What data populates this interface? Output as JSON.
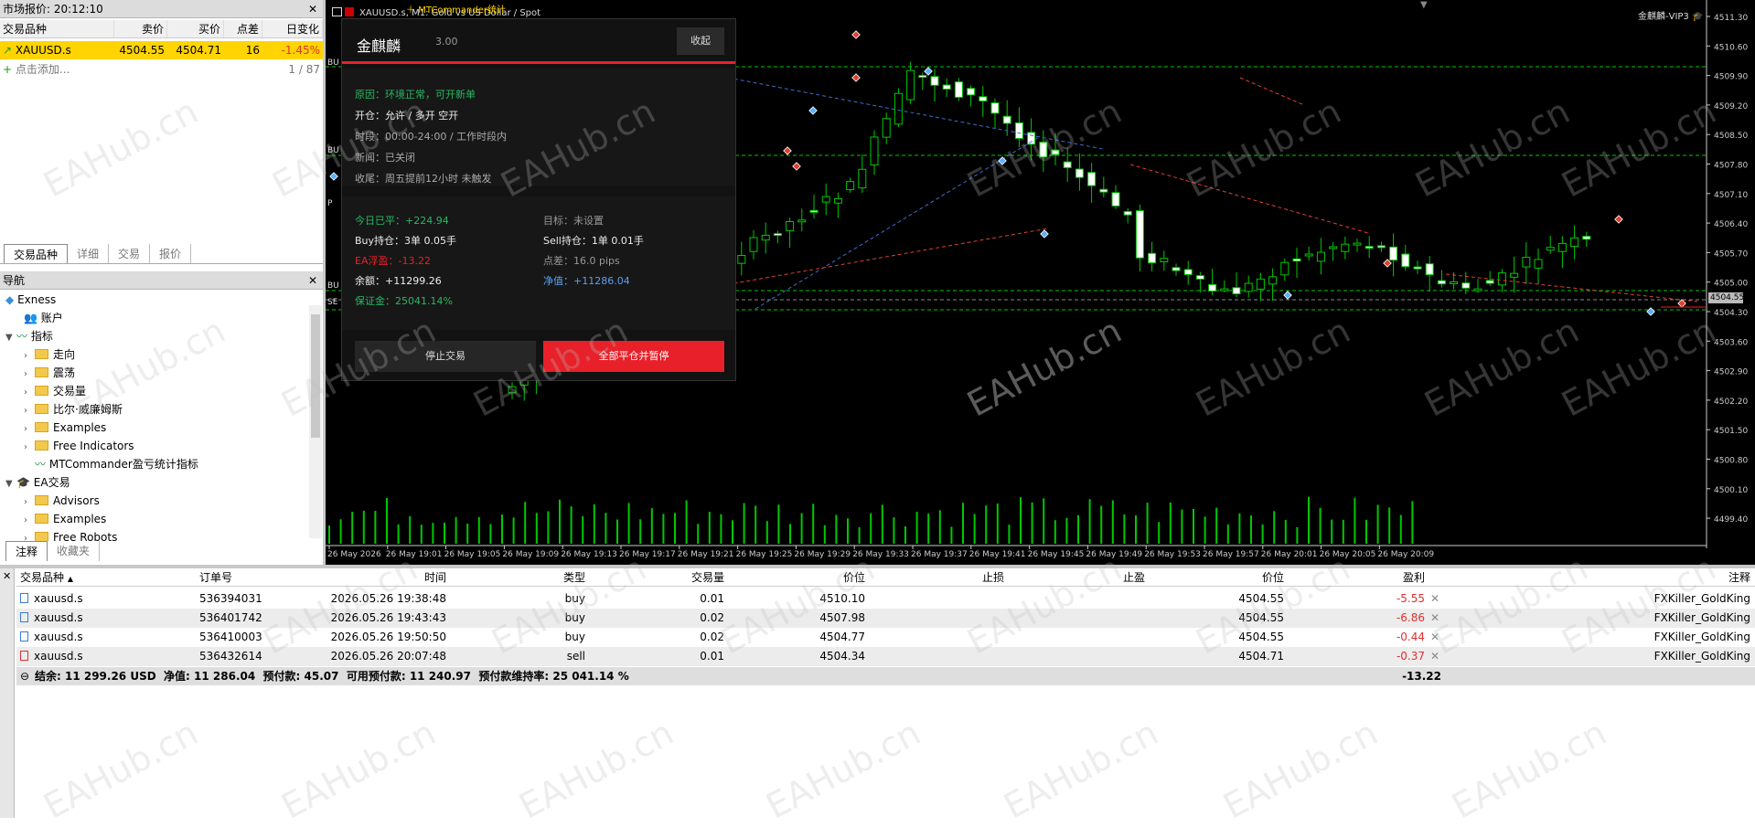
{
  "market_watch": {
    "title": "市场报价: 20:12:10",
    "columns": [
      "交易品种",
      "卖价",
      "买价",
      "点差",
      "日变化"
    ],
    "rows": [
      {
        "symbol": "XAUUSD.s",
        "bid": "4504.55",
        "ask": "4504.71",
        "spread": "16",
        "change": "-1.45%"
      }
    ],
    "add_label": "点击添加...",
    "count": "1 / 87",
    "tabs": [
      "交易品种",
      "详细",
      "交易",
      "报价"
    ]
  },
  "navigator": {
    "title": "导航",
    "items": [
      {
        "label": "Exness"
      },
      {
        "label": "账户"
      },
      {
        "label": "指标"
      },
      {
        "label": "走向"
      },
      {
        "label": "震荡"
      },
      {
        "label": "交易量"
      },
      {
        "label": "比尔·威廉姆斯"
      },
      {
        "label": "Examples"
      },
      {
        "label": "Free Indicators"
      },
      {
        "label": "MTCommander盈亏统计指标"
      },
      {
        "label": "EA交易"
      },
      {
        "label": "Advisors"
      },
      {
        "label": "Examples"
      },
      {
        "label": "Free Robots"
      }
    ],
    "tabs": [
      "注释",
      "收藏夹"
    ]
  },
  "chart": {
    "symbol_title": "XAUUSD.s, M1:  Gold vs US Dollar / Spot",
    "indicator_label": "MTCommander统计",
    "ea_label": "金麒麟-VIP3",
    "current_price": "4504.55",
    "price_ticks": [
      "4511.30",
      "4510.60",
      "4509.90",
      "4509.20",
      "4508.50",
      "4507.80",
      "4507.10",
      "4506.40",
      "4505.70",
      "4505.00",
      "4504.30",
      "4503.60",
      "4502.90",
      "4502.20",
      "4501.50",
      "4500.80",
      "4500.10",
      "4499.40"
    ],
    "time_ticks": [
      "26 May 2026",
      "26 May 19:01",
      "26 May 19:05",
      "26 May 19:09",
      "26 May 19:13",
      "26 May 19:17",
      "26 May 19:21",
      "26 May 19:25",
      "26 May 19:29",
      "26 May 19:33",
      "26 May 19:37",
      "26 May 19:41",
      "26 May 19:45",
      "26 May 19:49",
      "26 May 19:53",
      "26 May 19:57",
      "26 May 20:01",
      "26 May 20:05",
      "26 May 20:09"
    ],
    "side_labels": [
      "BU",
      "BU",
      "BU",
      "SE",
      "P"
    ]
  },
  "ea_panel": {
    "name": "金麒麟",
    "version": "3.00",
    "collapse": "收起",
    "reason_label": "原因：",
    "reason_value": "环境正常，可开新单",
    "open_label": "开仓：",
    "open_value": "允许 / 多开 空开",
    "session_label": "时段：",
    "session_value": "00:00-24:00 / 工作时段内",
    "news_label": "新闻：",
    "news_value": "已关闭",
    "close_label": "收尾：",
    "close_value": "周五提前12小时 未触发",
    "today_label": "今日已平：",
    "today_value": "+224.94",
    "target_label": "目标：",
    "target_value": "未设置",
    "buy_label": "Buy持仓：",
    "buy_value": "3单 0.05手",
    "sell_label": "Sell持仓：",
    "sell_value": "1单 0.01手",
    "ea_float_label": "EA浮盈：",
    "ea_float_value": "-13.22",
    "spread_label": "点差：",
    "spread_value": "16.0 pips",
    "balance_label": "余额：",
    "balance_value": "+11299.26",
    "equity_label": "净值：",
    "equity_value": "+11286.04",
    "margin_label": "保证金：",
    "margin_value": "25041.14%",
    "stop_btn": "停止交易",
    "closeall_btn": "全部平仓并暂停"
  },
  "trade": {
    "columns": [
      "交易品种",
      "订单号",
      "时间",
      "类型",
      "交易量",
      "价位",
      "止损",
      "止盈",
      "价位",
      "盈利",
      "注释"
    ],
    "rows": [
      {
        "symbol": "xauusd.s",
        "ticket": "536394031",
        "time": "2026.05.26 19:38:48",
        "type": "buy",
        "volume": "0.01",
        "price": "4510.10",
        "sl": "",
        "tp": "",
        "cur": "4504.55",
        "profit": "-5.55",
        "comment": "FXKiller_GoldKing"
      },
      {
        "symbol": "xauusd.s",
        "ticket": "536401742",
        "time": "2026.05.26 19:43:43",
        "type": "buy",
        "volume": "0.02",
        "price": "4507.98",
        "sl": "",
        "tp": "",
        "cur": "4504.55",
        "profit": "-6.86",
        "comment": "FXKiller_GoldKing"
      },
      {
        "symbol": "xauusd.s",
        "ticket": "536410003",
        "time": "2026.05.26 19:50:50",
        "type": "buy",
        "volume": "0.02",
        "price": "4504.77",
        "sl": "",
        "tp": "",
        "cur": "4504.55",
        "profit": "-0.44",
        "comment": "FXKiller_GoldKing"
      },
      {
        "symbol": "xauusd.s",
        "ticket": "536432614",
        "time": "2026.05.26 20:07:48",
        "type": "sell",
        "volume": "0.01",
        "price": "4504.34",
        "sl": "",
        "tp": "",
        "cur": "4504.71",
        "profit": "-0.37",
        "comment": "FXKiller_GoldKing"
      }
    ],
    "summary": "结余: 11 299.26 USD  净值: 11 286.04  预付款: 45.07  可用预付款: 11 240.97  预付款维持率: 25 041.14 %",
    "summary_profit": "-13.22"
  },
  "watermark": "EAHub.cn",
  "colors": {
    "up": "#00c800",
    "down": "#ffffff",
    "grid_line": "#00c800",
    "red": "#e8202a",
    "highlight": "#ffd400"
  }
}
